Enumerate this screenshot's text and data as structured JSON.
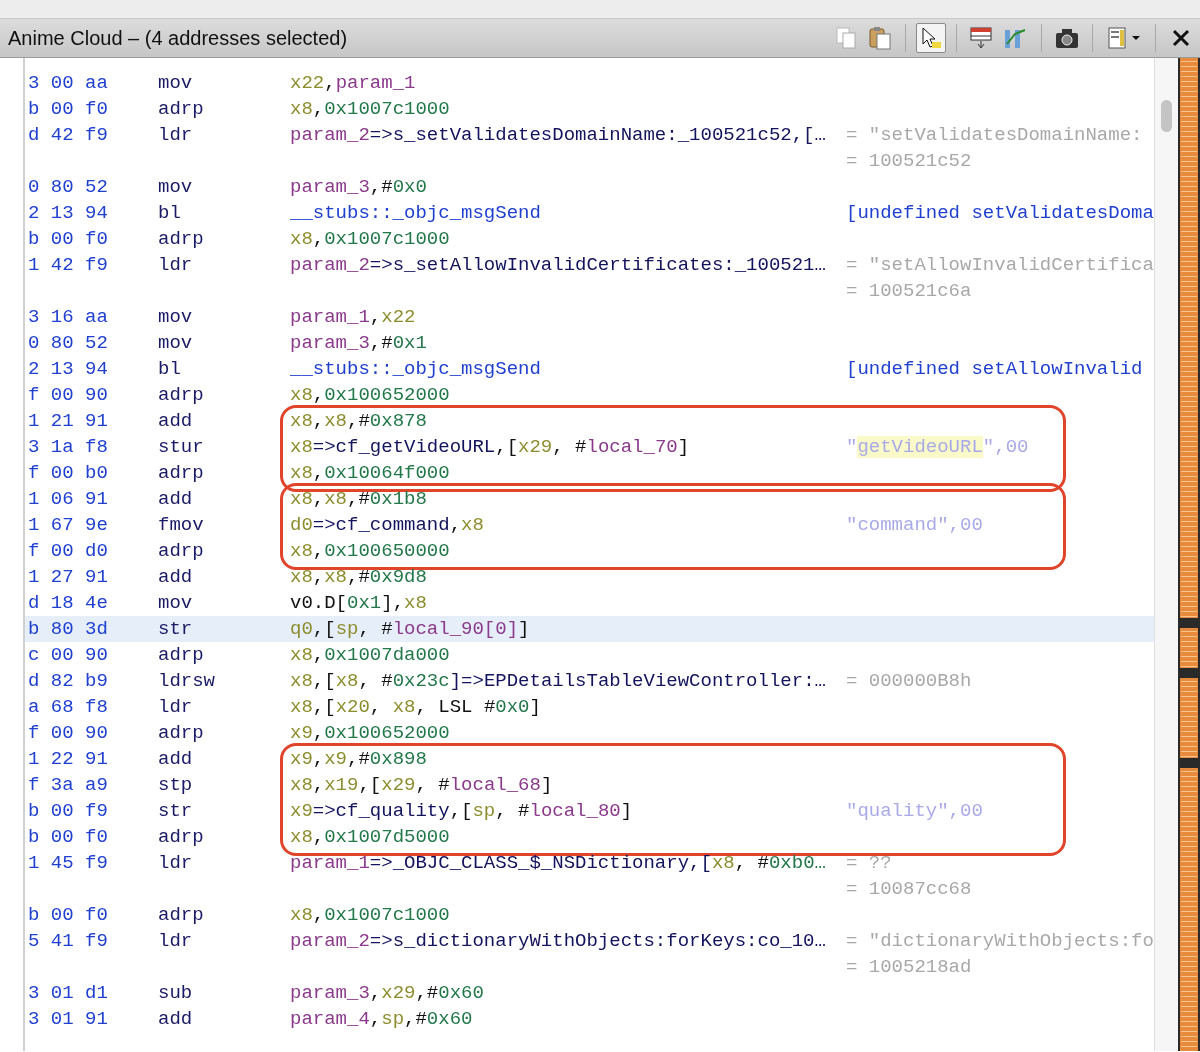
{
  "window": {
    "title": "Anime Cloud – (4 addresses selected)"
  },
  "toolbar": [
    {
      "kind": "copy",
      "pressed": false
    },
    {
      "kind": "paste",
      "pressed": false
    },
    {
      "kind": "select",
      "pressed": true
    },
    {
      "kind": "fields",
      "pressed": false
    },
    {
      "kind": "flow",
      "pressed": false
    },
    {
      "kind": "snapshot",
      "pressed": false
    },
    {
      "kind": "layout",
      "pressed": false
    },
    {
      "kind": "close",
      "pressed": false
    }
  ],
  "blocks": [
    {
      "circled": false,
      "rows": [
        {
          "bytes": "3 00 aa",
          "mnemonic": "mov",
          "selected": false,
          "operand": [
            {
              "text": "x22",
              "kind": "reg"
            },
            {
              "text": ",",
              "kind": "punct"
            },
            {
              "text": "param_1",
              "kind": "param"
            }
          ],
          "comments": []
        },
        {
          "bytes": "b 00 f0",
          "mnemonic": "adrp",
          "selected": false,
          "operand": [
            {
              "text": "x8",
              "kind": "reg"
            },
            {
              "text": ",",
              "kind": "punct"
            },
            {
              "text": "0x1007c1000",
              "kind": "num"
            }
          ],
          "comments": []
        },
        {
          "bytes": "d 42 f9",
          "mnemonic": "ldr",
          "selected": false,
          "operand": [
            {
              "text": "param_2",
              "kind": "param"
            },
            {
              "text": "=>s_setValidatesDomainName:_100521c52,[…",
              "kind": "sym"
            }
          ],
          "comments": [
            [
              {
                "text": "= \"setValidatesDomainName:",
                "kind": "value"
              }
            ],
            [
              {
                "text": "= 100521c52",
                "kind": "value"
              }
            ]
          ]
        },
        {
          "bytes": "0 80 52",
          "mnemonic": "mov",
          "selected": false,
          "operand": [
            {
              "text": "param_3",
              "kind": "param"
            },
            {
              "text": ",#",
              "kind": "punct"
            },
            {
              "text": "0x0",
              "kind": "num"
            }
          ],
          "comments": []
        },
        {
          "bytes": "2 13 94",
          "mnemonic": "bl",
          "selected": false,
          "operand": [
            {
              "text": "__stubs::_objc_msgSend",
              "kind": "call"
            }
          ],
          "comments": [
            [
              {
                "text": "[undefined setValidatesDoma",
                "kind": "call"
              }
            ]
          ]
        },
        {
          "bytes": "b 00 f0",
          "mnemonic": "adrp",
          "selected": false,
          "operand": [
            {
              "text": "x8",
              "kind": "reg"
            },
            {
              "text": ",",
              "kind": "punct"
            },
            {
              "text": "0x1007c1000",
              "kind": "num"
            }
          ],
          "comments": []
        },
        {
          "bytes": "1 42 f9",
          "mnemonic": "ldr",
          "selected": false,
          "operand": [
            {
              "text": "param_2",
              "kind": "param"
            },
            {
              "text": "=>s_setAllowInvalidCertificates:_100521…",
              "kind": "sym"
            }
          ],
          "comments": [
            [
              {
                "text": "= \"setAllowInvalidCertifica",
                "kind": "value"
              }
            ],
            [
              {
                "text": "= 100521c6a",
                "kind": "value"
              }
            ]
          ]
        },
        {
          "bytes": "3 16 aa",
          "mnemonic": "mov",
          "selected": false,
          "operand": [
            {
              "text": "param_1",
              "kind": "param"
            },
            {
              "text": ",",
              "kind": "punct"
            },
            {
              "text": "x22",
              "kind": "reg"
            }
          ],
          "comments": []
        },
        {
          "bytes": "0 80 52",
          "mnemonic": "mov",
          "selected": false,
          "operand": [
            {
              "text": "param_3",
              "kind": "param"
            },
            {
              "text": ",#",
              "kind": "punct"
            },
            {
              "text": "0x1",
              "kind": "num"
            }
          ],
          "comments": []
        },
        {
          "bytes": "2 13 94",
          "mnemonic": "bl",
          "selected": false,
          "operand": [
            {
              "text": "__stubs::_objc_msgSend",
              "kind": "call"
            }
          ],
          "comments": [
            [
              {
                "text": "[undefined setAllowInvalid",
                "kind": "call"
              }
            ]
          ]
        },
        {
          "bytes": "f 00 90",
          "mnemonic": "adrp",
          "selected": false,
          "operand": [
            {
              "text": "x8",
              "kind": "reg"
            },
            {
              "text": ",",
              "kind": "punct"
            },
            {
              "text": "0x100652000",
              "kind": "num"
            }
          ],
          "comments": []
        }
      ]
    },
    {
      "circled": true,
      "rows": [
        {
          "bytes": "1 21 91",
          "mnemonic": "add",
          "selected": false,
          "operand": [
            {
              "text": "x8",
              "kind": "reg"
            },
            {
              "text": ",",
              "kind": "punct"
            },
            {
              "text": "x8",
              "kind": "reg"
            },
            {
              "text": ",#",
              "kind": "punct"
            },
            {
              "text": "0x878",
              "kind": "num"
            }
          ],
          "comments": []
        },
        {
          "bytes": "3 1a f8",
          "mnemonic": "stur",
          "selected": false,
          "operand": [
            {
              "text": "x8",
              "kind": "reg"
            },
            {
              "text": "=>cf_getVideoURL",
              "kind": "sym"
            },
            {
              "text": ",[",
              "kind": "punct"
            },
            {
              "text": "x29",
              "kind": "reg"
            },
            {
              "text": ", #",
              "kind": "punct"
            },
            {
              "text": "local_70",
              "kind": "param"
            },
            {
              "text": "]",
              "kind": "punct"
            }
          ],
          "comments": [
            [
              {
                "text": "\"",
                "kind": "str"
              },
              {
                "text": "getVideoURL",
                "kind": "str-hl"
              },
              {
                "text": "\",00",
                "kind": "str"
              }
            ]
          ]
        },
        {
          "bytes": "f 00 b0",
          "mnemonic": "adrp",
          "selected": false,
          "operand": [
            {
              "text": "x8",
              "kind": "reg"
            },
            {
              "text": ",",
              "kind": "punct"
            },
            {
              "text": "0x10064f000",
              "kind": "num"
            }
          ],
          "comments": []
        }
      ]
    },
    {
      "circled": true,
      "rows": [
        {
          "bytes": "1 06 91",
          "mnemonic": "add",
          "selected": false,
          "operand": [
            {
              "text": "x8",
              "kind": "reg"
            },
            {
              "text": ",",
              "kind": "punct"
            },
            {
              "text": "x8",
              "kind": "reg"
            },
            {
              "text": ",#",
              "kind": "punct"
            },
            {
              "text": "0x1b8",
              "kind": "num"
            }
          ],
          "comments": []
        },
        {
          "bytes": "1 67 9e",
          "mnemonic": "fmov",
          "selected": false,
          "operand": [
            {
              "text": "d0",
              "kind": "reg"
            },
            {
              "text": "=>cf_command",
              "kind": "sym"
            },
            {
              "text": ",",
              "kind": "punct"
            },
            {
              "text": "x8",
              "kind": "reg"
            }
          ],
          "comments": [
            [
              {
                "text": "\"command\",00",
                "kind": "str"
              }
            ]
          ]
        },
        {
          "bytes": "f 00 d0",
          "mnemonic": "adrp",
          "selected": false,
          "operand": [
            {
              "text": "x8",
              "kind": "reg"
            },
            {
              "text": ",",
              "kind": "punct"
            },
            {
              "text": "0x100650000",
              "kind": "num"
            }
          ],
          "comments": []
        }
      ]
    },
    {
      "circled": false,
      "rows": [
        {
          "bytes": "1 27 91",
          "mnemonic": "add",
          "selected": false,
          "operand": [
            {
              "text": "x8",
              "kind": "reg"
            },
            {
              "text": ",",
              "kind": "punct"
            },
            {
              "text": "x8",
              "kind": "reg"
            },
            {
              "text": ",#",
              "kind": "punct"
            },
            {
              "text": "0x9d8",
              "kind": "num"
            }
          ],
          "comments": []
        },
        {
          "bytes": "d 18 4e",
          "mnemonic": "mov",
          "selected": false,
          "operand": [
            {
              "text": "v0.D[",
              "kind": "punct"
            },
            {
              "text": "0x1",
              "kind": "num"
            },
            {
              "text": "],",
              "kind": "punct"
            },
            {
              "text": "x8",
              "kind": "reg"
            }
          ],
          "comments": []
        },
        {
          "bytes": "b 80 3d",
          "mnemonic": "str",
          "selected": true,
          "operand": [
            {
              "text": "q0",
              "kind": "reg"
            },
            {
              "text": ",[",
              "kind": "punct"
            },
            {
              "text": "sp",
              "kind": "reg"
            },
            {
              "text": ", #",
              "kind": "punct"
            },
            {
              "text": "local_90[0]",
              "kind": "param"
            },
            {
              "text": "]",
              "kind": "punct"
            }
          ],
          "comments": []
        },
        {
          "bytes": "c 00 90",
          "mnemonic": "adrp",
          "selected": false,
          "operand": [
            {
              "text": "x8",
              "kind": "reg"
            },
            {
              "text": ",",
              "kind": "punct"
            },
            {
              "text": "0x1007da000",
              "kind": "num"
            }
          ],
          "comments": []
        },
        {
          "bytes": "d 82 b9",
          "mnemonic": "ldrsw",
          "selected": false,
          "operand": [
            {
              "text": "x8",
              "kind": "reg"
            },
            {
              "text": ",[",
              "kind": "punct"
            },
            {
              "text": "x8",
              "kind": "reg"
            },
            {
              "text": ", #",
              "kind": "punct"
            },
            {
              "text": "0x23c",
              "kind": "num"
            },
            {
              "text": "]=>EPDetailsTableViewController:…",
              "kind": "sym"
            }
          ],
          "comments": [
            [
              {
                "text": "= 000000B8h",
                "kind": "value"
              }
            ]
          ]
        },
        {
          "bytes": "a 68 f8",
          "mnemonic": "ldr",
          "selected": false,
          "operand": [
            {
              "text": "x8",
              "kind": "reg"
            },
            {
              "text": ",[",
              "kind": "punct"
            },
            {
              "text": "x20",
              "kind": "reg"
            },
            {
              "text": ", ",
              "kind": "punct"
            },
            {
              "text": "x8",
              "kind": "reg"
            },
            {
              "text": ", LSL #",
              "kind": "punct"
            },
            {
              "text": "0x0",
              "kind": "num"
            },
            {
              "text": "]",
              "kind": "punct"
            }
          ],
          "comments": []
        },
        {
          "bytes": "f 00 90",
          "mnemonic": "adrp",
          "selected": false,
          "operand": [
            {
              "text": "x9",
              "kind": "reg"
            },
            {
              "text": ",",
              "kind": "punct"
            },
            {
              "text": "0x100652000",
              "kind": "num"
            }
          ],
          "comments": []
        }
      ]
    },
    {
      "circled": true,
      "rows": [
        {
          "bytes": "1 22 91",
          "mnemonic": "add",
          "selected": false,
          "operand": [
            {
              "text": "x9",
              "kind": "reg"
            },
            {
              "text": ",",
              "kind": "punct"
            },
            {
              "text": "x9",
              "kind": "reg"
            },
            {
              "text": ",#",
              "kind": "punct"
            },
            {
              "text": "0x898",
              "kind": "num"
            }
          ],
          "comments": []
        },
        {
          "bytes": "f 3a a9",
          "mnemonic": "stp",
          "selected": false,
          "operand": [
            {
              "text": "x8",
              "kind": "reg"
            },
            {
              "text": ",",
              "kind": "punct"
            },
            {
              "text": "x19",
              "kind": "reg"
            },
            {
              "text": ",[",
              "kind": "punct"
            },
            {
              "text": "x29",
              "kind": "reg"
            },
            {
              "text": ", #",
              "kind": "punct"
            },
            {
              "text": "local_68",
              "kind": "param"
            },
            {
              "text": "]",
              "kind": "punct"
            }
          ],
          "comments": []
        },
        {
          "bytes": "b 00 f9",
          "mnemonic": "str",
          "selected": false,
          "operand": [
            {
              "text": "x9",
              "kind": "reg"
            },
            {
              "text": "=>cf_quality",
              "kind": "sym"
            },
            {
              "text": ",[",
              "kind": "punct"
            },
            {
              "text": "sp",
              "kind": "reg"
            },
            {
              "text": ", #",
              "kind": "punct"
            },
            {
              "text": "local_80",
              "kind": "param"
            },
            {
              "text": "]",
              "kind": "punct"
            }
          ],
          "comments": [
            [
              {
                "text": "\"quality\",00",
                "kind": "str"
              }
            ]
          ]
        },
        {
          "bytes": "b 00 f0",
          "mnemonic": "adrp",
          "selected": false,
          "operand": [
            {
              "text": "x8",
              "kind": "reg"
            },
            {
              "text": ",",
              "kind": "punct"
            },
            {
              "text": "0x1007d5000",
              "kind": "num"
            }
          ],
          "comments": []
        }
      ]
    },
    {
      "circled": false,
      "rows": [
        {
          "bytes": "1 45 f9",
          "mnemonic": "ldr",
          "selected": false,
          "operand": [
            {
              "text": "param_1",
              "kind": "param"
            },
            {
              "text": "=>_OBJC_CLASS_$_NSDictionary,[",
              "kind": "sym"
            },
            {
              "text": "x8",
              "kind": "reg"
            },
            {
              "text": ", #",
              "kind": "punct"
            },
            {
              "text": "0xb0…",
              "kind": "num"
            }
          ],
          "comments": [
            [
              {
                "text": "= ??",
                "kind": "value"
              }
            ],
            [
              {
                "text": "= 10087cc68",
                "kind": "value"
              }
            ]
          ]
        },
        {
          "bytes": "b 00 f0",
          "mnemonic": "adrp",
          "selected": false,
          "operand": [
            {
              "text": "x8",
              "kind": "reg"
            },
            {
              "text": ",",
              "kind": "punct"
            },
            {
              "text": "0x1007c1000",
              "kind": "num"
            }
          ],
          "comments": []
        },
        {
          "bytes": "5 41 f9",
          "mnemonic": "ldr",
          "selected": false,
          "operand": [
            {
              "text": "param_2",
              "kind": "param"
            },
            {
              "text": "=>s_dictionaryWithObjects:forKeys:co_10…",
              "kind": "sym"
            }
          ],
          "comments": [
            [
              {
                "text": "= \"dictionaryWithObjects:fo",
                "kind": "value"
              }
            ],
            [
              {
                "text": "= 1005218ad",
                "kind": "value"
              }
            ]
          ]
        },
        {
          "bytes": "3 01 d1",
          "mnemonic": "sub",
          "selected": false,
          "operand": [
            {
              "text": "param_3",
              "kind": "param"
            },
            {
              "text": ",",
              "kind": "punct"
            },
            {
              "text": "x29",
              "kind": "reg"
            },
            {
              "text": ",#",
              "kind": "punct"
            },
            {
              "text": "0x60",
              "kind": "num"
            }
          ],
          "comments": []
        },
        {
          "bytes": "3 01 91",
          "mnemonic": "add",
          "selected": false,
          "operand": [
            {
              "text": "param_4",
              "kind": "param"
            },
            {
              "text": ",",
              "kind": "punct"
            },
            {
              "text": "sp",
              "kind": "reg"
            },
            {
              "text": ",#",
              "kind": "punct"
            },
            {
              "text": "0x60",
              "kind": "num"
            }
          ],
          "comments": []
        }
      ]
    }
  ]
}
